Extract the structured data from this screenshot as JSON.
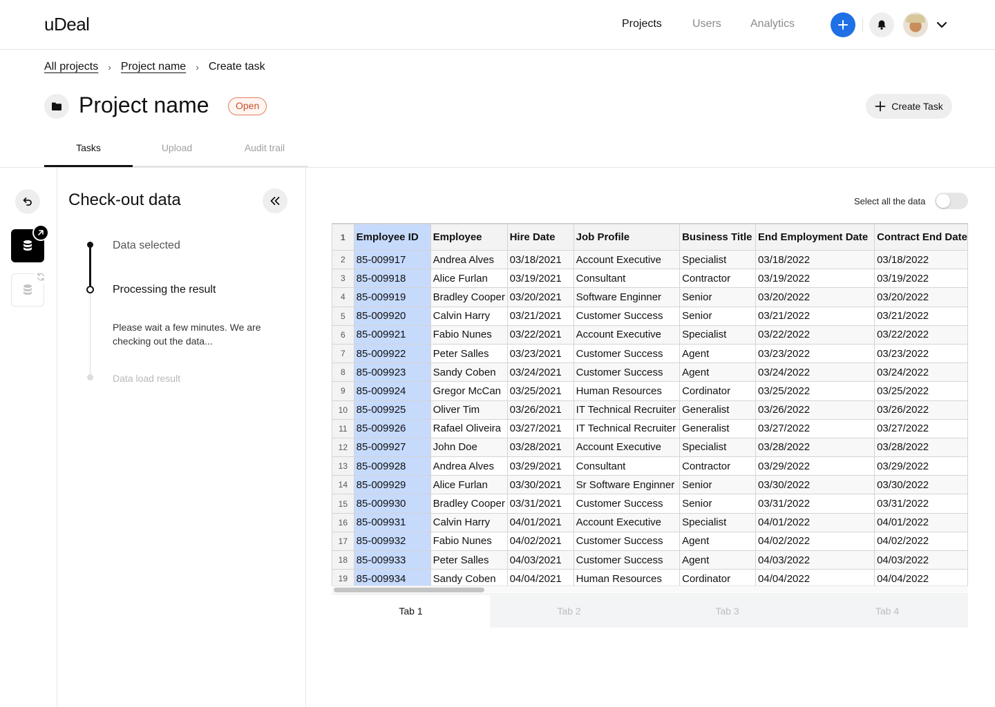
{
  "header": {
    "logo": "uDeal",
    "nav": [
      "Projects",
      "Users",
      "Analytics"
    ],
    "active_nav": "Projects"
  },
  "breadcrumb": {
    "items": [
      "All projects",
      "Project name"
    ],
    "current": "Create task"
  },
  "project": {
    "title": "Project name",
    "status": "Open",
    "create_task_label": "Create Task"
  },
  "tabs": [
    "Tasks",
    "Upload",
    "Audit trail"
  ],
  "panel": {
    "title": "Check-out data",
    "steps": [
      {
        "label": "Data selected"
      },
      {
        "label": "Processing the result",
        "description": "Please wait a few minutes. We are checking out the data..."
      },
      {
        "label": "Data load result"
      }
    ]
  },
  "sheet": {
    "select_all_label": "Select all the data",
    "columns": [
      "Employee ID",
      "Employee",
      "Hire Date",
      "Job Profile",
      "Business Title",
      "End Employment Date",
      "Contract End Date"
    ],
    "rows": [
      [
        "85-009917",
        "Andrea Alves",
        "03/18/2021",
        "Account Executive",
        "Specialist",
        "03/18/2022",
        "03/18/2022"
      ],
      [
        "85-009918",
        "Alice Furlan",
        "03/19/2021",
        "Consultant",
        "Contractor",
        "03/19/2022",
        "03/19/2022"
      ],
      [
        "85-009919",
        "Bradley Cooper",
        "03/20/2021",
        "Software Enginner",
        "Senior",
        "03/20/2022",
        "03/20/2022"
      ],
      [
        "85-009920",
        "Calvin Harry",
        "03/21/2021",
        "Customer Success",
        "Senior",
        "03/21/2022",
        "03/21/2022"
      ],
      [
        "85-009921",
        "Fabio Nunes",
        "03/22/2021",
        "Account Executive",
        "Specialist",
        "03/22/2022",
        "03/22/2022"
      ],
      [
        "85-009922",
        "Peter Salles",
        "03/23/2021",
        "Customer Success",
        "Agent",
        "03/23/2022",
        "03/23/2022"
      ],
      [
        "85-009923",
        "Sandy Coben",
        "03/24/2021",
        "Customer Success",
        "Agent",
        "03/24/2022",
        "03/24/2022"
      ],
      [
        "85-009924",
        "Gregor McCan",
        "03/25/2021",
        "Human Resources",
        "Cordinator",
        "03/25/2022",
        "03/25/2022"
      ],
      [
        "85-009925",
        "Oliver Tim",
        "03/26/2021",
        "IT Technical Recruiter",
        "Generalist",
        "03/26/2022",
        "03/26/2022"
      ],
      [
        "85-009926",
        "Rafael Oliveira",
        "03/27/2021",
        "IT Technical Recruiter",
        "Generalist",
        "03/27/2022",
        "03/27/2022"
      ],
      [
        "85-009927",
        "John Doe",
        "03/28/2021",
        "Account Executive",
        "Specialist",
        "03/28/2022",
        "03/28/2022"
      ],
      [
        "85-009928",
        "Andrea Alves",
        "03/29/2021",
        "Consultant",
        "Contractor",
        "03/29/2022",
        "03/29/2022"
      ],
      [
        "85-009929",
        "Alice Furlan",
        "03/30/2021",
        "Sr Software Enginner",
        "Senior",
        "03/30/2022",
        "03/30/2022"
      ],
      [
        "85-009930",
        "Bradley Cooper",
        "03/31/2021",
        "Customer Success",
        "Senior",
        "03/31/2022",
        "03/31/2022"
      ],
      [
        "85-009931",
        "Calvin Harry",
        "04/01/2021",
        "Account Executive",
        "Specialist",
        "04/01/2022",
        "04/01/2022"
      ],
      [
        "85-009932",
        "Fabio Nunes",
        "04/02/2021",
        "Customer Success",
        "Agent",
        "04/02/2022",
        "04/02/2022"
      ],
      [
        "85-009933",
        "Peter Salles",
        "04/03/2021",
        "Customer Success",
        "Agent",
        "04/03/2022",
        "04/03/2022"
      ],
      [
        "85-009934",
        "Sandy Coben",
        "04/04/2021",
        "Human Resources",
        "Cordinator",
        "04/04/2022",
        "04/04/2022"
      ]
    ],
    "sheet_tabs": [
      "Tab 1",
      "Tab 2",
      "Tab 3",
      "Tab 4"
    ]
  },
  "colors": {
    "accent": "#1f6fe5",
    "status_open": "#c7512f",
    "selected_column": "#c6dafc"
  },
  "icons": [
    "plus-icon",
    "bell-icon",
    "chevron-down-icon",
    "folder-icon",
    "undo-icon",
    "database-icon",
    "external-arrow-icon",
    "sync-icon",
    "double-chevron-left-icon"
  ]
}
